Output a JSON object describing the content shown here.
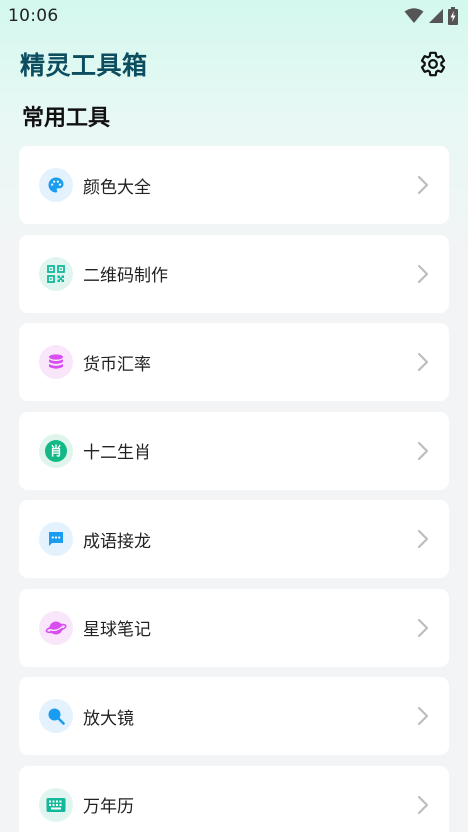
{
  "status_bar": {
    "time": "10:06"
  },
  "header": {
    "title": "精灵工具箱"
  },
  "section": {
    "title": "常用工具"
  },
  "tools": [
    {
      "label": "颜色大全",
      "icon": "palette-icon",
      "color": "#1a9cf0",
      "bg": "#e3f2fd"
    },
    {
      "label": "二维码制作",
      "icon": "qr-code-icon",
      "color": "#14b89a",
      "bg": "#e0f5ef"
    },
    {
      "label": "货币汇率",
      "icon": "coin-stack-icon",
      "color": "#d94ef0",
      "bg": "#f9e6fb"
    },
    {
      "label": "十二生肖",
      "icon": "zodiac-icon",
      "color": "#12b886",
      "bg": "#dff5ec",
      "glyph": "肖"
    },
    {
      "label": "成语接龙",
      "icon": "chat-bubble-icon",
      "color": "#1a9cf0",
      "bg": "#e3f2fd"
    },
    {
      "label": "星球笔记",
      "icon": "planet-icon",
      "color": "#d94ef0",
      "bg": "#f9e6fb"
    },
    {
      "label": "放大镜",
      "icon": "magnifier-icon",
      "color": "#1a9cf0",
      "bg": "#e3f2fd"
    },
    {
      "label": "万年历",
      "icon": "keyboard-icon",
      "color": "#14b89a",
      "bg": "#e0f5ef"
    }
  ]
}
